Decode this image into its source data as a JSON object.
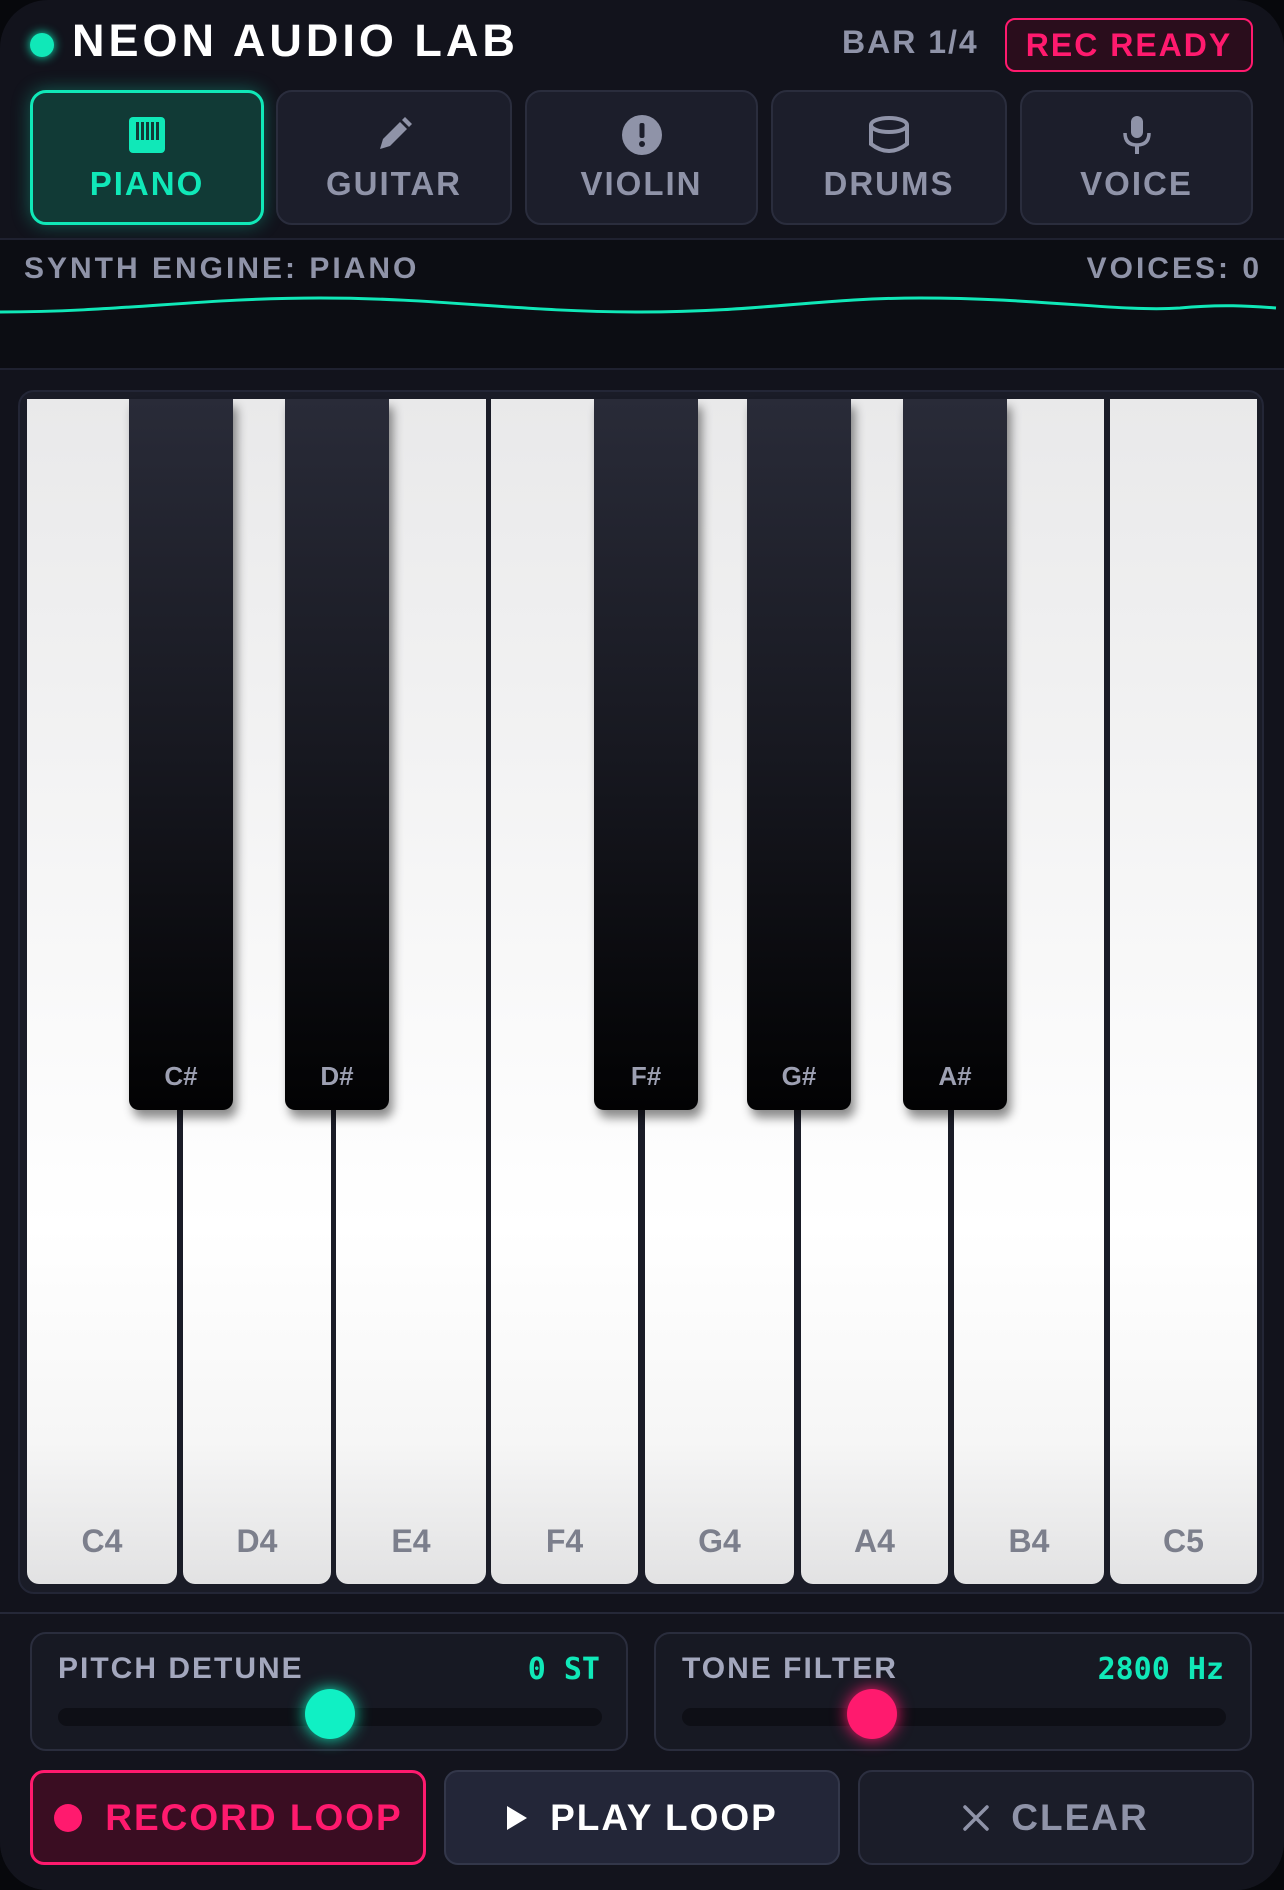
{
  "header": {
    "title": "NEON AUDIO LAB",
    "bar": "BAR 1/4",
    "rec_status": "REC READY"
  },
  "tabs": [
    {
      "label": "PIANO",
      "icon": "piano-icon",
      "active": true
    },
    {
      "label": "GUITAR",
      "icon": "pencil-icon",
      "active": false
    },
    {
      "label": "VIOLIN",
      "icon": "alert-circle-icon",
      "active": false
    },
    {
      "label": "DRUMS",
      "icon": "drum-icon",
      "active": false
    },
    {
      "label": "VOICE",
      "icon": "microphone-icon",
      "active": false
    }
  ],
  "engine": {
    "label": "SYNTH ENGINE: PIANO",
    "voices": "VOICES: 0"
  },
  "keyboard": {
    "white_keys": [
      "C4",
      "D4",
      "E4",
      "F4",
      "G4",
      "A4",
      "B4",
      "C5"
    ],
    "black_keys": [
      "C#",
      "D#",
      "F#",
      "G#",
      "A#"
    ]
  },
  "controls": {
    "pitch": {
      "label": "PITCH DETUNE",
      "value": "0 ST",
      "level": 0.5
    },
    "tone": {
      "label": "TONE FILTER",
      "value": "2800 Hz",
      "level": 0.35
    },
    "record_label": "RECORD LOOP",
    "play_label": "PLAY LOOP",
    "clear_label": "CLEAR"
  },
  "colors": {
    "accent": "#10e8b8",
    "record": "#ff1a6e",
    "background": "#12131c"
  }
}
